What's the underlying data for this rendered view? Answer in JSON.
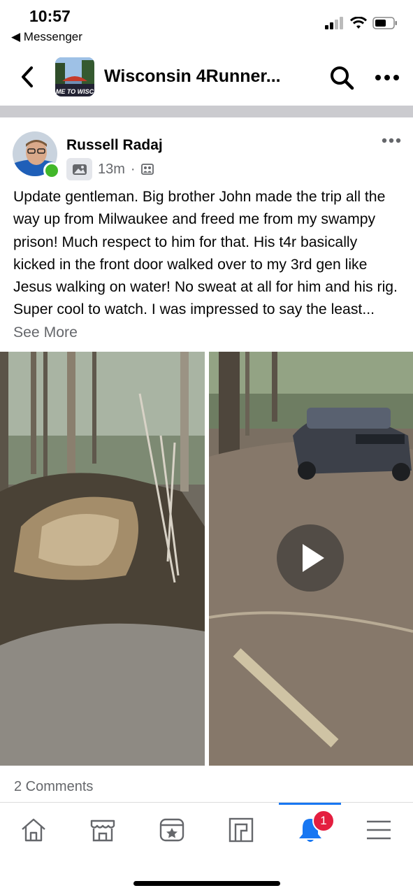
{
  "status_bar": {
    "time": "10:57",
    "back_app": "◀ Messenger"
  },
  "header": {
    "title": "Wisconsin 4Runner...",
    "group_thumb_text": "ME TO WISC"
  },
  "post": {
    "author": "Russell Radaj",
    "time": "13m",
    "text": "Update gentleman. Big brother John made the trip all the way up from Milwaukee and freed me from my swampy prison! Much respect to him for that. His t4r basically kicked in the front door walked over to my 3rd gen like Jesus walking on water! No sweat at all for him and his rig. Super cool to watch. I was impressed to say the least...",
    "see_more": "See More",
    "media": [
      {
        "type": "photo",
        "description": "muddy-trail-photo"
      },
      {
        "type": "video",
        "description": "4runner-video"
      }
    ],
    "comments": "2 Comments"
  },
  "tabbar": {
    "items": [
      {
        "icon": "home-icon"
      },
      {
        "icon": "marketplace-icon"
      },
      {
        "icon": "favorites-icon"
      },
      {
        "icon": "groups-icon"
      },
      {
        "icon": "notifications-icon",
        "active": true,
        "badge": "1"
      },
      {
        "icon": "menu-icon"
      }
    ]
  },
  "colors": {
    "accent": "#1877f2",
    "badge": "#e41e3f",
    "online": "#42b72a"
  }
}
